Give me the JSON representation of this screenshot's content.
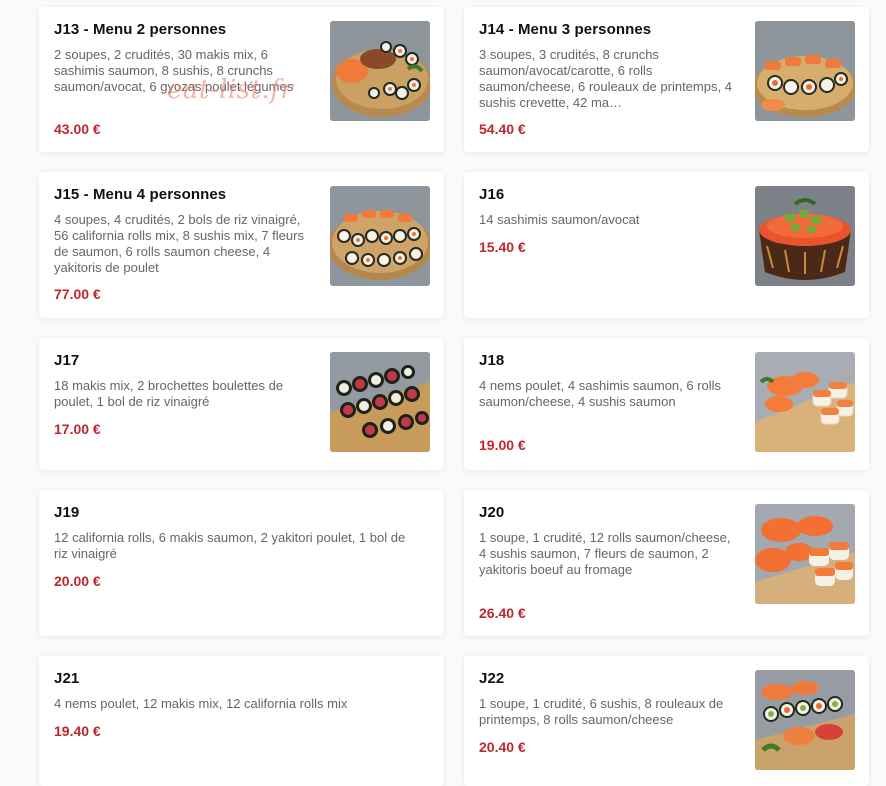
{
  "watermark": "eat-list.fr",
  "items": [
    {
      "name": "J13 - Menu 2 personnes",
      "desc": "2 soupes, 2 crudités, 30 makis mix, 6 sashimis saumon, 8 sushis, 8 crunchs saumon/avocat, 6 gyozas poulet légumes",
      "price": "43.00 €",
      "image_icon": "sushi-platter-photo"
    },
    {
      "name": "J14 - Menu 3 personnes",
      "desc": "3 soupes, 3 crudités, 8 crunchs saumon/avocat/carotte, 6 rolls saumon/cheese, 6 rouleaux de printemps, 4 sushis crevette, 42 ma…",
      "price": "54.40 €",
      "image_icon": "sushi-platter-photo"
    },
    {
      "name": "J15 - Menu 4 personnes",
      "desc": "4 soupes, 4 crudités, 2 bols de riz vinaigré, 56 california rolls mix, 8 sushis mix, 7 fleurs de saumon, 6 rolls saumon cheese, 4 yakitoris de poulet",
      "price": "77.00 €",
      "image_icon": "sushi-platter-photo"
    },
    {
      "name": "J16",
      "desc": "14 sashimis saumon/avocat",
      "price": "15.40 €",
      "image_icon": "chirashi-bowl-photo"
    },
    {
      "name": "J17",
      "desc": "18 makis mix, 2 brochettes boulettes de poulet, 1 bol de riz vinaigré",
      "price": "17.00 €",
      "image_icon": "maki-board-photo"
    },
    {
      "name": "J18",
      "desc": "4 nems poulet, 4 sashimis saumon, 6 rolls saumon/cheese, 4 sushis saumon",
      "price": "19.00 €",
      "image_icon": "salmon-sushi-photo"
    },
    {
      "name": "J19",
      "desc": "12 california rolls, 6 makis saumon, 2 yakitori poulet, 1 bol de riz vinaigré",
      "price": "20.00 €",
      "image_icon": ""
    },
    {
      "name": "J20",
      "desc": "1 soupe, 1 crudité, 12 rolls saumon/cheese, 4 sushis saumon, 7 fleurs de saumon, 2 yakitoris boeuf au fromage",
      "price": "26.40 €",
      "image_icon": "salmon-sushi-photo"
    },
    {
      "name": "J21",
      "desc": "4 nems poulet, 12 makis mix, 12 california rolls mix",
      "price": "19.40 €",
      "image_icon": ""
    },
    {
      "name": "J22",
      "desc": "1 soupe, 1 crudité, 6 sushis, 8 rouleaux de printemps, 8 rolls saumon/cheese",
      "price": "20.40 €",
      "image_icon": "sushi-platter-photo"
    }
  ],
  "colors": {
    "price": "#c0262d",
    "card_bg": "#ffffff",
    "page_bg": "#fafafa"
  }
}
